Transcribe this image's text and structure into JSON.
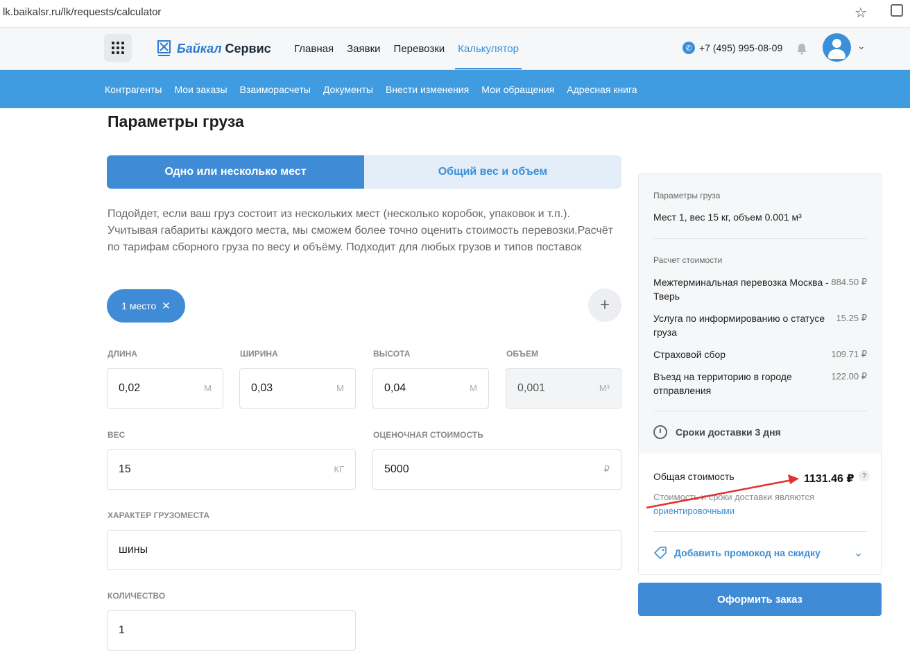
{
  "browser": {
    "url": "lk.baikalsr.ru/lk/requests/calculator"
  },
  "header": {
    "logo_part1": "Байкал",
    "logo_part2": "Сервис",
    "nav": [
      {
        "label": "Главная",
        "active": false
      },
      {
        "label": "Заявки",
        "active": false
      },
      {
        "label": "Перевозки",
        "active": false
      },
      {
        "label": "Калькулятор",
        "active": true
      }
    ],
    "phone": "+7 (495) 995-08-09"
  },
  "subnav": [
    "Контрагенты",
    "Мои заказы",
    "Взаиморасчеты",
    "Документы",
    "Внести изменения",
    "Мои обращения",
    "Адресная книга"
  ],
  "page": {
    "title": "Параметры груза",
    "tabs": [
      "Одно или несколько мест",
      "Общий вес и объем"
    ],
    "description": "Подойдет, если ваш груз состоит из нескольких мест (несколько коробок, упаковок и т.п.). Учитывая габариты каждого места, мы сможем более точно оценить стоимость перевозки.Расчёт по тарифам сборного груза по весу и объёму. Подходит для любых грузов и типов поставок",
    "place_chip": "1 место",
    "fields": {
      "length": {
        "label": "ДЛИНА",
        "value": "0,02",
        "unit": "М"
      },
      "width": {
        "label": "ШИРИНА",
        "value": "0,03",
        "unit": "М"
      },
      "height": {
        "label": "ВЫСОТА",
        "value": "0,04",
        "unit": "М"
      },
      "volume": {
        "label": "ОБЪЕМ",
        "value": "0,001",
        "unit": "М³"
      },
      "weight": {
        "label": "ВЕС",
        "value": "15",
        "unit": "КГ"
      },
      "declared": {
        "label": "ОЦЕНОЧНАЯ СТОИМОСТЬ",
        "value": "5000",
        "unit": "₽"
      },
      "cargo_type": {
        "label": "ХАРАКТЕР ГРУЗОМЕСТА",
        "value": "шины"
      },
      "quantity": {
        "label": "КОЛИЧЕСТВО",
        "value": "1"
      }
    }
  },
  "summary": {
    "params_label": "Параметры груза",
    "params_value": "Мест 1, вес 15 кг, объем 0.001 м³",
    "calc_label": "Расчет стоимости",
    "items": [
      {
        "name": "Межтерминальная перевозка Москва - Тверь",
        "price": "884.50 ₽"
      },
      {
        "name": "Услуга по информированию о статусе груза",
        "price": "15.25 ₽"
      },
      {
        "name": "Страховой сбор",
        "price": "109.71 ₽"
      },
      {
        "name": "Въезд на территорию в городе отправления",
        "price": "122.00 ₽"
      }
    ],
    "delivery": "Сроки доставки 3 дня",
    "total_label": "Общая стоимость",
    "total_value": "1131.46 ₽",
    "help": "?",
    "note_prefix": "Стоимость и сроки доставки являются",
    "note_link": "ориентировочными",
    "promo": "Добавить промокод на скидку",
    "order_button": "Оформить заказ"
  },
  "colors": {
    "accent": "#3f8bd6",
    "subnav": "#3f9ce0",
    "annotation_arrow": "#e03030"
  }
}
